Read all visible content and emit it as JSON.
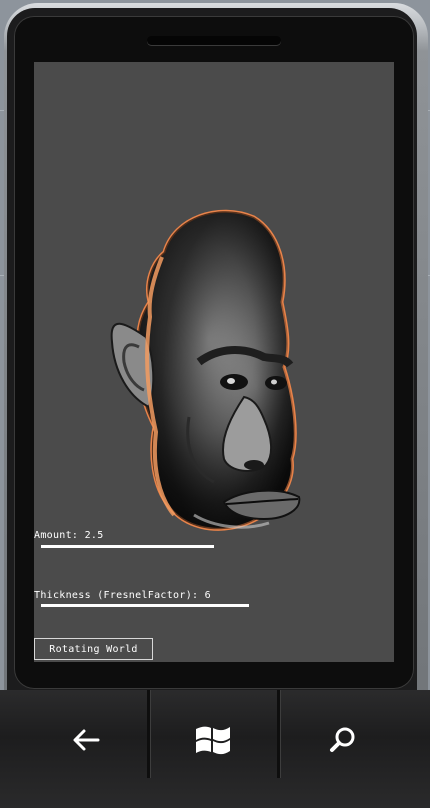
{
  "controls": {
    "amount_label": "Amount: 2.5",
    "amount_value": 2.5,
    "thickness_label": "Thickness (FresnelFactor): 6",
    "thickness_value": 6,
    "world_button_label": "Rotating World"
  },
  "nav": {
    "back_icon": "back-arrow-icon",
    "start_icon": "windows-logo-icon",
    "search_icon": "search-icon"
  },
  "colors": {
    "screen_background": "#4b4b4b",
    "rim_light": "#e8834a",
    "text": "#ffffff"
  }
}
